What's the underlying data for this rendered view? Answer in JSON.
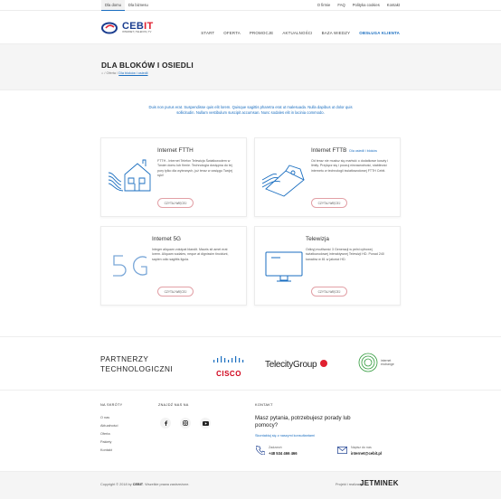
{
  "topbar": {
    "left": [
      "Dla domu",
      "Dla biznesu"
    ],
    "right": [
      "O firmie",
      "FAQ",
      "Polityka cookies",
      "Kontakt"
    ]
  },
  "logo": {
    "brand_a": "CEB",
    "brand_b": "IT",
    "tagline": "INTERNET | TELEFON | TV"
  },
  "nav": [
    "START",
    "OFERTA",
    "PROMOCJE",
    "AKTUALNOŚCI",
    "BAZA WIEDZY",
    "OBSŁUGA KLIENTA"
  ],
  "hero": {
    "title": "DLA BLOKÓW I OSIEDLI",
    "crumb_home": "⌂",
    "crumb_sep1": "/",
    "crumb_oferta": "Oferta",
    "crumb_sep2": "/",
    "crumb_current": "Dla bloków i osiedli"
  },
  "intro": "Duis non purus erat. Suspendisse quis elit lorem. Quisque sagittis pharetra erat ut malesuada. Nulla dapibus ut dolor quis sollicitudin. Nullam vestibulum suscipit accumsan. Nunc sodales elit in lacinia commodo.",
  "cards": [
    {
      "title": "Internet FTTH",
      "sub": "",
      "desc": "FTTH - Internet Telefon Telewizja Światłowodem w Twoim domu lub firmie. Technologia dostępna do tej pory tylko dla wybranych, już teraz w zasięgu Twojej ręki!",
      "button": "CZYTAJ WIĘCEJ"
    },
    {
      "title": "Internet FTTB",
      "sub": "Dla osiedli i bloków",
      "desc": "Od teraz nie musisz się martwić o dodatkowe koszty i limity. Przyłącz się i poczuj niezawodność, stabilność internetu w technologii światłowodowej FTTH Cebit.",
      "button": "CZYTAJ WIĘCEJ"
    },
    {
      "title": "Internet 5G",
      "sub": "",
      "desc": "Integer aliquam volutpat blandit. Mauris sit amet erat lorem. Aliquam sodales, neque at dignissim tincidunt, sapien odio sagittis ligula.",
      "button": "CZYTAJ WIĘCEJ"
    },
    {
      "title": "Telewizja",
      "sub": "",
      "desc": "Odkryj możliwość 3 Generacji w pełni cyfrowej światłowodowej interaktywnej Telewizji HD. Ponad 240 kanałów w 81 w jakości HD.",
      "button": "CZYTAJ WIĘCEJ"
    }
  ],
  "partners": {
    "heading_line1": "PARTNERZY",
    "heading_line2": "TECHNOLOGICZNI",
    "cisco": "CISCO",
    "telecity": "TelecityGroup",
    "exchange_line1": "internet",
    "exchange_line2": "exchange"
  },
  "footer": {
    "col1_heading": "NA SKRÓTY",
    "links": [
      "O nas",
      "Aktualności",
      "Oferta",
      "Pakiety",
      "Kontakt"
    ],
    "col2_heading": "ZNAJDŹ NAS NA",
    "col3_heading": "KONTAKT",
    "question": "Masz pytania, potrzebujesz porady lub pomocy?",
    "consult": "Skontaktuj się z naszymi konsultantami",
    "call_label": "Zadzwoń",
    "phone": "+48 534 466 466",
    "mail_label": "Napisz do nas",
    "email": "internet@cebit.pl"
  },
  "bottom": {
    "copy_prefix": "Copyright © 2018 by",
    "copy_brand": "CEBIT",
    "copy_suffix": ". Wszelkie prawa zastrzeżone.",
    "realizacja": "Projekt i realizacja:",
    "agency": "JETMINEK"
  },
  "colors": {
    "accent": "#1a6ec0",
    "brand_red": "#e02030",
    "navy": "#1a3d8f"
  }
}
